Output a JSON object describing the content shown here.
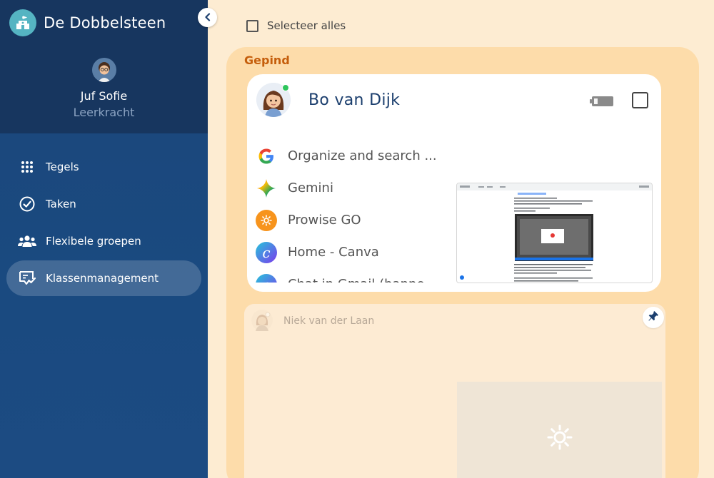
{
  "app": {
    "title": "De Dobbelsteen"
  },
  "profile": {
    "name": "Juf Sofie",
    "role": "Leerkracht"
  },
  "nav": [
    {
      "label": "Tegels",
      "icon": "grid-icon",
      "active": false
    },
    {
      "label": "Taken",
      "icon": "check-circle-icon",
      "active": false
    },
    {
      "label": "Flexibele groepen",
      "icon": "people-icon",
      "active": false
    },
    {
      "label": "Klassenmanagement",
      "icon": "screen-check-icon",
      "active": true
    }
  ],
  "main": {
    "select_all": "Selecteer alles",
    "pinned_label": "Gepind",
    "students": [
      {
        "name": "Bo van Dijk",
        "online": true,
        "tabs": [
          {
            "label": "Organize and search ...",
            "icon": "google-icon"
          },
          {
            "label": "Gemini",
            "icon": "gemini-icon"
          },
          {
            "label": "Prowise GO",
            "icon": "prowise-icon"
          },
          {
            "label": "Home - Canva",
            "icon": "canva-icon"
          },
          {
            "label": "Chat in Gmail (banne",
            "icon": "canva-icon"
          }
        ]
      },
      {
        "name": "Niek van der Laan",
        "online": false
      }
    ]
  },
  "colors": {
    "sidebar": "#1c467a",
    "accent": "#c55e0c",
    "panel": "#fddcaa",
    "logo": "#55b4c2"
  }
}
